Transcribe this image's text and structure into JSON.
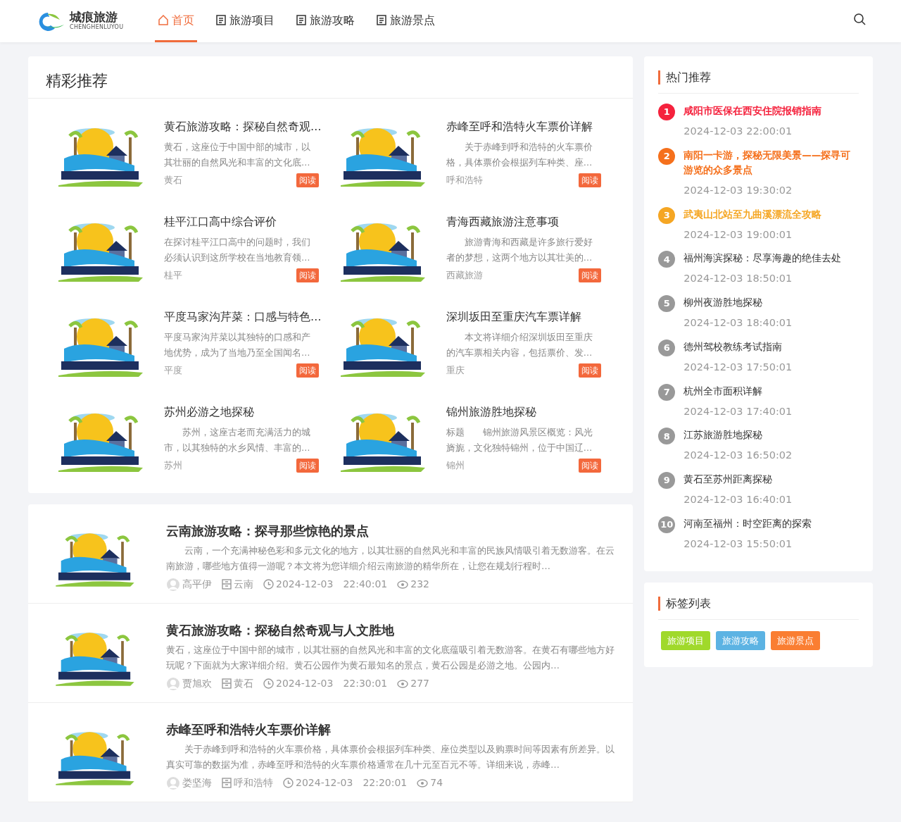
{
  "logo": {
    "name": "城痕旅游",
    "subtitle": "CHENGHENLUYOU"
  },
  "nav": [
    {
      "label": "首页",
      "kind": "home",
      "selected": true
    },
    {
      "label": "旅游项目",
      "kind": "doc",
      "selected": false
    },
    {
      "label": "旅游攻略",
      "kind": "doc",
      "selected": false
    },
    {
      "label": "旅游景点",
      "kind": "doc",
      "selected": false
    }
  ],
  "featured": {
    "title": "精彩推荐",
    "items": [
      {
        "title": "黄石旅游攻略：探秘自然奇观…",
        "excerpt": "黄石，这座位于中国中部的城市，以其壮丽的自然风光和丰富的文化底…",
        "tag": "黄石",
        "button": "阅读"
      },
      {
        "title": "赤峰至呼和浩特火车票价详解",
        "excerpt": "　　关于赤峰到呼和浩特的火车票价格，具体票价会根据列车种类、座…",
        "tag": "呼和浩特",
        "button": "阅读"
      },
      {
        "title": "桂平江口高中综合评价",
        "excerpt": "在探讨桂平江口高中的问题时，我们必须认识到这所学校在当地教育领…",
        "tag": "桂平",
        "button": "阅读"
      },
      {
        "title": "青海西藏旅游注意事项",
        "excerpt": "　　旅游青海和西藏是许多旅行爱好者的梦想，这两个地方以其壮美的…",
        "tag": "西藏旅游",
        "button": "阅读"
      },
      {
        "title": "平度马家沟芹菜：口感与特色…",
        "excerpt": "平度马家沟芹菜以其独特的口感和产地优势，成为了当地乃至全国闻名…",
        "tag": "平度",
        "button": "阅读"
      },
      {
        "title": "深圳坂田至重庆汽车票详解",
        "excerpt": "　　本文将详细介绍深圳坂田至重庆的汽车票相关内容，包括票价、发…",
        "tag": "重庆",
        "button": "阅读"
      },
      {
        "title": "苏州必游之地探秘",
        "excerpt": "　　苏州，这座古老而充满活力的城市，以其独特的水乡风情、丰富的…",
        "tag": "苏州",
        "button": "阅读"
      },
      {
        "title": "锦州旅游胜地探秘",
        "excerpt": "标题　　锦州旅游风景区概览：风光旖旎，文化独特锦州，位于中国辽…",
        "tag": "锦州",
        "button": "阅读"
      }
    ]
  },
  "articles": [
    {
      "title": "云南旅游攻略：探寻那些惊艳的景点",
      "excerpt": "　　云南，一个充满神秘色彩和多元文化的地方，以其壮丽的自然风光和丰富的民族风情吸引着无数游客。在云南旅游，哪些地方值得一游呢？本文将为您详细介绍云南旅游的精华所在，让您在规划行程时…",
      "author": "高平伊",
      "category": "云南",
      "date": "2024-12-03",
      "time": "22:40:01",
      "views": "232"
    },
    {
      "title": "黄石旅游攻略：探秘自然奇观与人文胜地",
      "excerpt": "黄石，这座位于中国中部的城市，以其壮丽的自然风光和丰富的文化底蕴吸引着无数游客。在黄石有哪些地方好玩呢？下面就为大家详细介绍。黄石公园作为黄石最知名的景点，黄石公园是必游之地。公园内…",
      "author": "贾旭欢",
      "category": "黄石",
      "date": "2024-12-03",
      "time": "22:30:01",
      "views": "277"
    },
    {
      "title": "赤峰至呼和浩特火车票价详解",
      "excerpt": "　　关于赤峰到呼和浩特的火车票价格，具体票价会根据列车种类、座位类型以及购票时间等因素有所差异。以真实可靠的数据为准，赤峰至呼和浩特的火车票价格通常在几十元至百元不等。详细来说，赤峰…",
      "author": "娄坚海",
      "category": "呼和浩特",
      "date": "2024-12-03",
      "time": "22:20:01",
      "views": "74"
    }
  ],
  "hot": {
    "title": "热门推荐",
    "items": [
      {
        "rank": "1",
        "title": "咸阳市医保在西安住院报销指南",
        "time": "2024-12-03 22:00:01",
        "color": "#f5223d",
        "hot": true
      },
      {
        "rank": "2",
        "title": "南阳一卡游，探秘无限美景——探寻可游览的众多景点",
        "time": "2024-12-03 19:30:02",
        "color": "#f5701c",
        "hot": true
      },
      {
        "rank": "3",
        "title": "武夷山北站至九曲溪漂流全攻略",
        "time": "2024-12-03 19:00:01",
        "color": "#f5a623",
        "hot": true
      },
      {
        "rank": "4",
        "title": "福州海滨探秘：尽享海趣的绝佳去处",
        "time": "2024-12-03 18:50:01",
        "color": "#999999",
        "hot": false
      },
      {
        "rank": "5",
        "title": "柳州夜游胜地探秘",
        "time": "2024-12-03 18:40:01",
        "color": "#999999",
        "hot": false
      },
      {
        "rank": "6",
        "title": "德州驾校教练考试指南",
        "time": "2024-12-03 17:50:01",
        "color": "#999999",
        "hot": false
      },
      {
        "rank": "7",
        "title": "杭州全市面积详解",
        "time": "2024-12-03 17:40:01",
        "color": "#999999",
        "hot": false
      },
      {
        "rank": "8",
        "title": "江苏旅游胜地探秘",
        "time": "2024-12-03 16:50:02",
        "color": "#999999",
        "hot": false
      },
      {
        "rank": "9",
        "title": "黄石至苏州距离探秘",
        "time": "2024-12-03 16:40:01",
        "color": "#999999",
        "hot": false
      },
      {
        "rank": "10",
        "title": "河南至福州：时空距离的探索",
        "time": "2024-12-03 15:50:01",
        "color": "#999999",
        "hot": false
      }
    ]
  },
  "tags": {
    "title": "标签列表",
    "items": [
      {
        "label": "旅游项目",
        "color": "#a0d92b"
      },
      {
        "label": "旅游攻略",
        "color": "#5cb3e3"
      },
      {
        "label": "旅游景点",
        "color": "#fa7e32"
      }
    ]
  }
}
